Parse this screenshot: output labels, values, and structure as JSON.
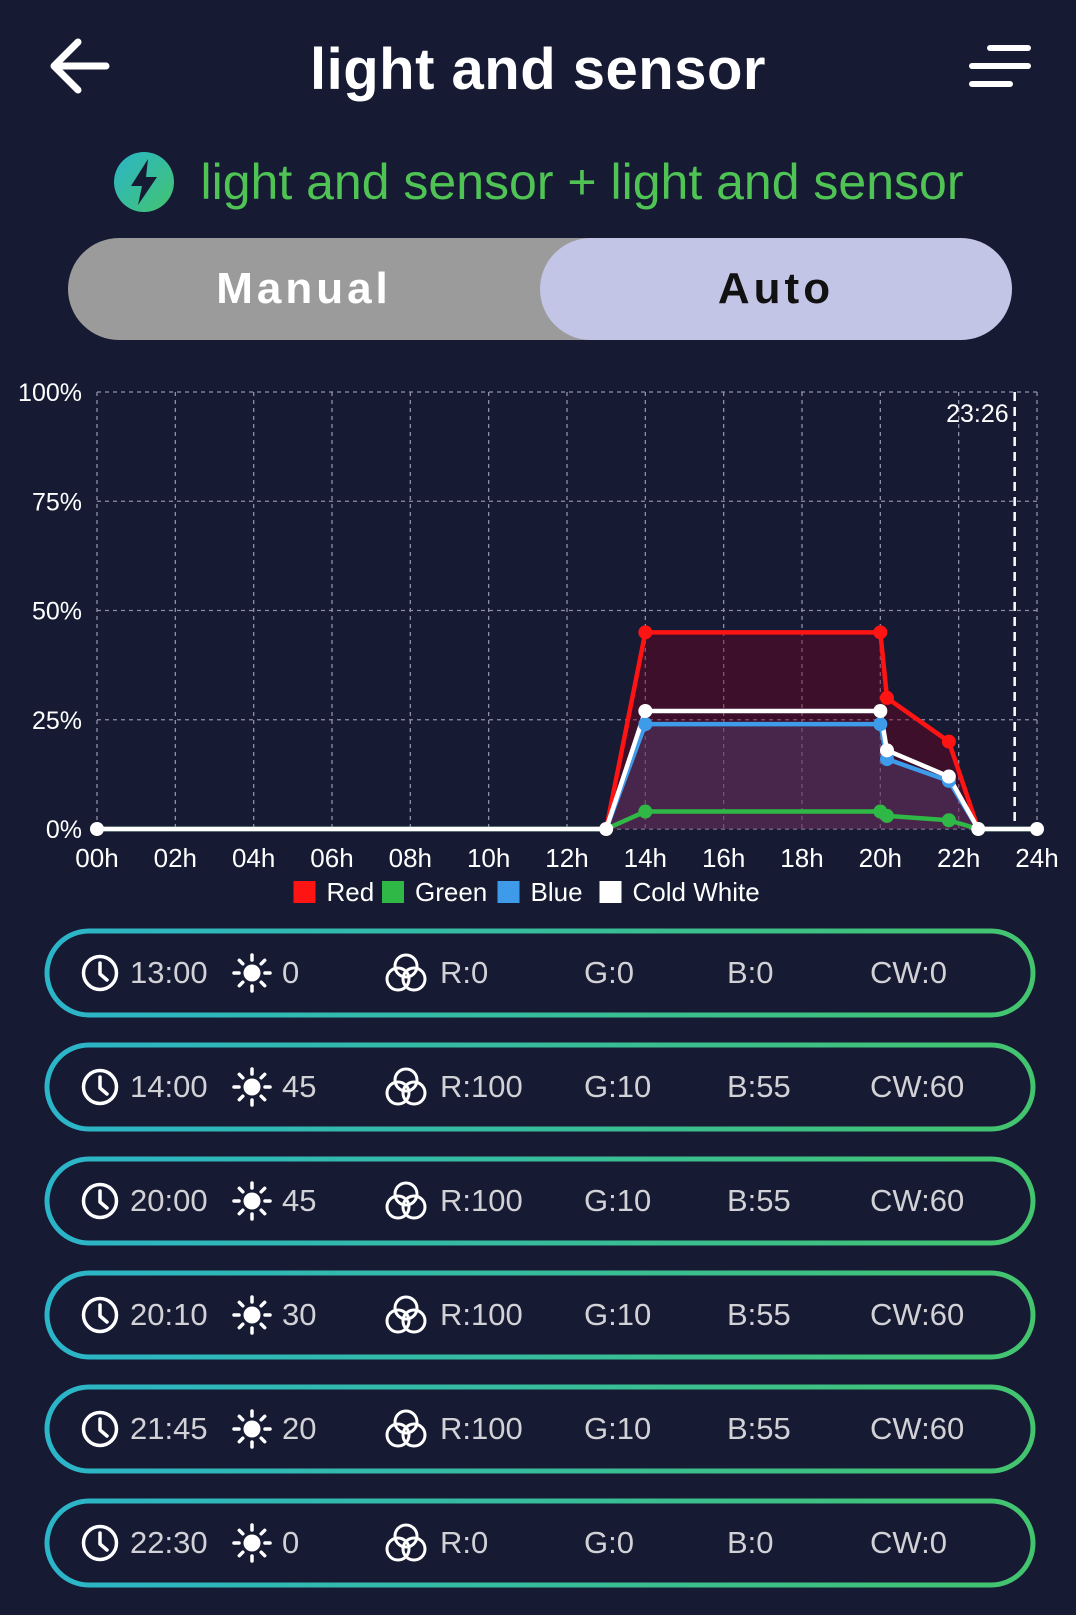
{
  "header": {
    "title": "light and sensor",
    "back_icon": "arrow-left-icon",
    "menu_icon": "menu-lines-icon"
  },
  "device": {
    "name": "light and sensor + light and sensor",
    "icon": "lightning-bolt-icon",
    "color": "#4fc455"
  },
  "mode_toggle": {
    "manual_label": "Manual",
    "auto_label": "Auto",
    "selected": "Auto"
  },
  "chart_data": {
    "type": "line",
    "xlabel": "",
    "ylabel": "",
    "x_ticks": [
      "00h",
      "02h",
      "04h",
      "06h",
      "08h",
      "10h",
      "12h",
      "14h",
      "16h",
      "18h",
      "20h",
      "22h",
      "24h"
    ],
    "y_ticks": [
      "100%",
      "75%",
      "50%",
      "25%",
      "0%"
    ],
    "xlim": [
      0,
      24
    ],
    "ylim": [
      0,
      100
    ],
    "grid": true,
    "legend_position": "bottom",
    "current_time": {
      "hour": 23.43,
      "label": "23:26"
    },
    "series": [
      {
        "name": "Red",
        "color": "#ff1414",
        "x": [
          0,
          13,
          14,
          20,
          20.17,
          21.75,
          22.5,
          24
        ],
        "y": [
          0,
          0,
          45,
          45,
          30,
          20,
          0,
          0
        ]
      },
      {
        "name": "Green",
        "color": "#2fb845",
        "x": [
          0,
          13,
          14,
          20,
          20.17,
          21.75,
          22.5,
          24
        ],
        "y": [
          0,
          0,
          4,
          4,
          3,
          2,
          0,
          0
        ]
      },
      {
        "name": "Blue",
        "color": "#3d9bea",
        "x": [
          0,
          13,
          14,
          20,
          20.17,
          21.75,
          22.5,
          24
        ],
        "y": [
          0,
          0,
          24,
          24,
          16,
          11,
          0,
          0
        ]
      },
      {
        "name": "Cold White",
        "color": "#ffffff",
        "x": [
          0,
          13,
          14,
          20,
          20.17,
          21.75,
          22.5,
          24
        ],
        "y": [
          0,
          0,
          27,
          27,
          18,
          12,
          0,
          0
        ]
      }
    ]
  },
  "schedule": [
    {
      "time": "13:00",
      "brightness": "0",
      "r": "R:0",
      "g": "G:0",
      "b": "B:0",
      "cw": "CW:0"
    },
    {
      "time": "14:00",
      "brightness": "45",
      "r": "R:100",
      "g": "G:10",
      "b": "B:55",
      "cw": "CW:60"
    },
    {
      "time": "20:00",
      "brightness": "45",
      "r": "R:100",
      "g": "G:10",
      "b": "B:55",
      "cw": "CW:60"
    },
    {
      "time": "20:10",
      "brightness": "30",
      "r": "R:100",
      "g": "G:10",
      "b": "B:55",
      "cw": "CW:60"
    },
    {
      "time": "21:45",
      "brightness": "20",
      "r": "R:100",
      "g": "G:10",
      "b": "B:55",
      "cw": "CW:60"
    },
    {
      "time": "22:30",
      "brightness": "0",
      "r": "R:0",
      "g": "G:0",
      "b": "B:0",
      "cw": "CW:0"
    }
  ],
  "icons": {
    "row_time": "clock-icon",
    "row_brightness": "sun-icon",
    "row_color": "rgb-circles-icon"
  },
  "colors": {
    "background": "#161a33",
    "row_border_start": "#2bb5c9",
    "row_border_end": "#43c46e"
  }
}
